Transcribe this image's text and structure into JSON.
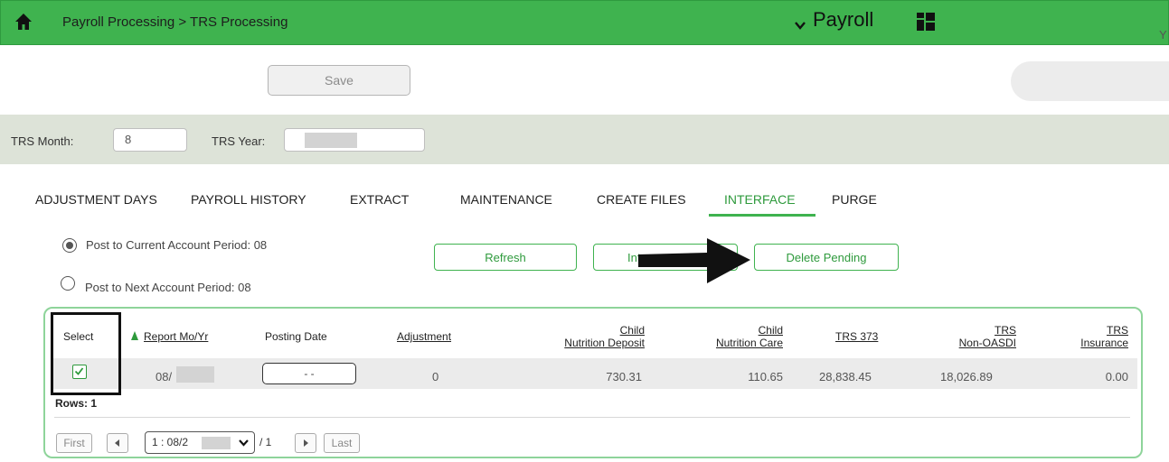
{
  "header": {
    "breadcrumb": "Payroll Processing > TRS Processing",
    "module": "Payroll",
    "icons": [
      "home-icon",
      "chevron-down-icon",
      "apps-grid-icon"
    ]
  },
  "toolbar": {
    "save_label": "Save",
    "search_pill_text": "Y"
  },
  "filters": {
    "trs_month_label": "TRS Month:",
    "trs_month_value": "8",
    "trs_year_label": "TRS Year:"
  },
  "tabs": [
    {
      "label": "ADJUSTMENT DAYS"
    },
    {
      "label": "PAYROLL HISTORY"
    },
    {
      "label": "EXTRACT"
    },
    {
      "label": "MAINTENANCE"
    },
    {
      "label": "CREATE FILES"
    },
    {
      "label": "INTERFACE",
      "active": true
    },
    {
      "label": "PURGE"
    }
  ],
  "options": {
    "current_period": "Post to Current Account Period: 08",
    "next_period": "Post to Next Account Period: 08"
  },
  "actions": {
    "refresh": "Refresh",
    "interface": "Int",
    "delete_pending": "Delete Pending"
  },
  "grid": {
    "columns": {
      "select": "Select",
      "report_mo_yr": "Report Mo/Yr",
      "posting_date": "Posting Date",
      "adjustment": "Adjustment",
      "child_nutrition_deposit_1": "Child",
      "child_nutrition_deposit_2": "Nutrition Deposit",
      "child_nutrition_care_1": "Child",
      "child_nutrition_care_2": "Nutrition Care",
      "trs_373": "TRS 373",
      "trs_non_oasdi_1": "TRS",
      "trs_non_oasdi_2": "Non-OASDI",
      "trs_insurance_1": "TRS",
      "trs_insurance_2": "Insurance"
    },
    "row": {
      "report_mo_yr": "08/",
      "posting_date": "- -",
      "adjustment": "0",
      "child_nutrition_deposit": "730.31",
      "child_nutrition_care": "110.65",
      "trs_373": "28,838.45",
      "trs_non_oasdi": "18,026.89",
      "trs_insurance": "0.00"
    },
    "rows_label": "Rows: 1"
  },
  "pager": {
    "first": "First",
    "last": "Last",
    "page_select": "1 : 08/2",
    "of_total": "/ 1"
  },
  "colors": {
    "accent": "#3fb34f",
    "accent_text": "#2e9a3c",
    "filter_bg": "#dde3d8"
  }
}
